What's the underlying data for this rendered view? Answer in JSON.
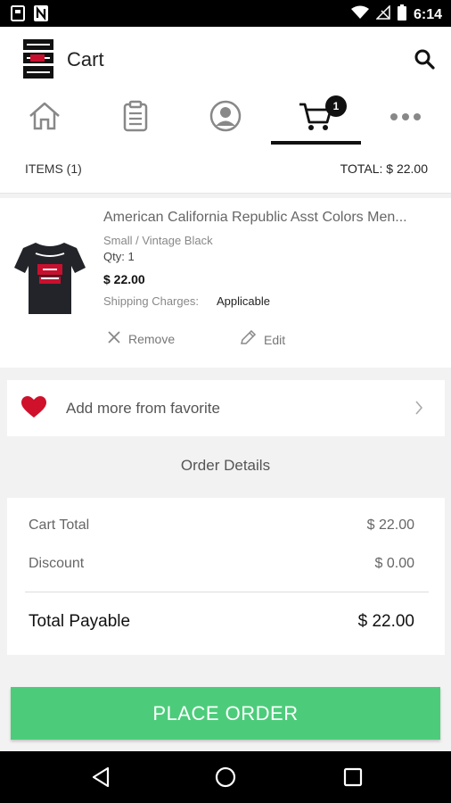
{
  "status_bar": {
    "time": "6:14"
  },
  "app_bar": {
    "title": "Cart"
  },
  "tabs": [
    {
      "name": "home",
      "icon": "home-icon"
    },
    {
      "name": "orders",
      "icon": "clipboard-icon"
    },
    {
      "name": "profile",
      "icon": "user-icon"
    },
    {
      "name": "cart",
      "icon": "cart-icon",
      "badge": "1",
      "active": true
    },
    {
      "name": "more",
      "icon": "more-icon"
    }
  ],
  "summary": {
    "items": "ITEMS (1)",
    "total": "TOTAL: $ 22.00"
  },
  "cart_item": {
    "name": "American California Republic Asst Colors Men...",
    "variant": "Small / Vintage Black",
    "qty": "Qty: 1",
    "price": "$ 22.00",
    "shipping_label": "Shipping Charges:",
    "shipping_value": "Applicable",
    "remove_label": "Remove",
    "edit_label": "Edit"
  },
  "favorite": {
    "label": "Add more from favorite"
  },
  "order_details": {
    "title": "Order Details",
    "cart_total_label": "Cart Total",
    "cart_total_value": "$ 22.00",
    "discount_label": "Discount",
    "discount_value": "$ 0.00",
    "total_payable_label": "Total Payable",
    "total_payable_value": "$ 22.00"
  },
  "place_order": {
    "label": "PLACE ORDER"
  },
  "colors": {
    "accent": "#4ccc7a",
    "heart": "#d0112b"
  }
}
